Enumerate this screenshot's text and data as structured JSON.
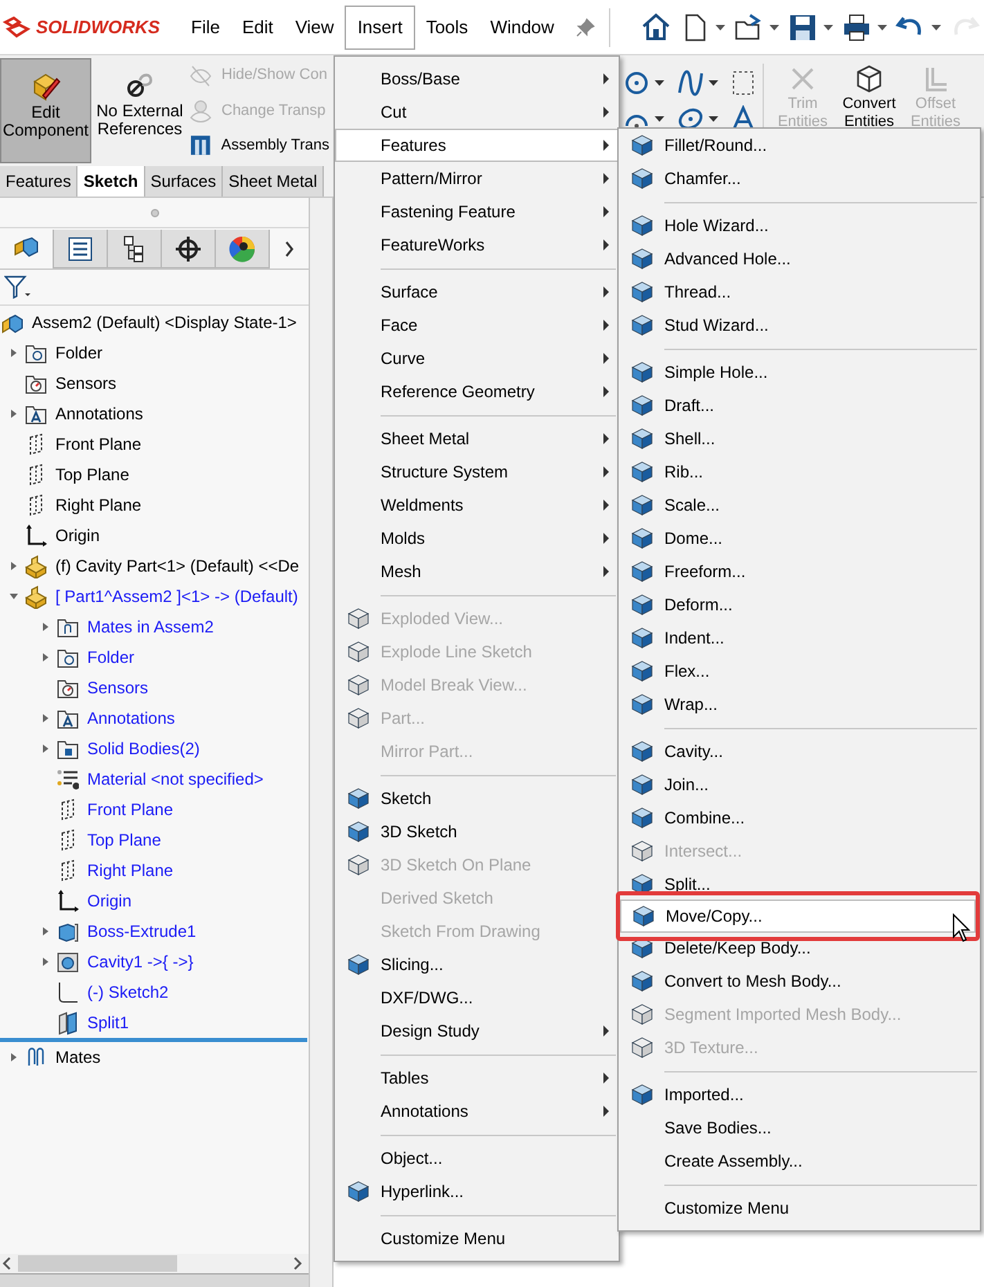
{
  "app": {
    "logo": "SOLIDWORKS"
  },
  "menu_bar": [
    {
      "label": "File",
      "selected": false
    },
    {
      "label": "Edit",
      "selected": false
    },
    {
      "label": "View",
      "selected": false
    },
    {
      "label": "Insert",
      "selected": true
    },
    {
      "label": "Tools",
      "selected": false
    },
    {
      "label": "Window",
      "selected": false
    }
  ],
  "quick_access": [
    {
      "kind": "home",
      "dropdown": false,
      "disabled": false
    },
    {
      "kind": "new",
      "dropdown": true,
      "disabled": false
    },
    {
      "kind": "open",
      "dropdown": true,
      "disabled": false
    },
    {
      "kind": "save",
      "dropdown": true,
      "disabled": false
    },
    {
      "kind": "print",
      "dropdown": true,
      "disabled": false
    },
    {
      "kind": "undo",
      "dropdown": true,
      "disabled": false
    },
    {
      "kind": "redo",
      "dropdown": false,
      "disabled": true
    }
  ],
  "command_manager": {
    "large_buttons": [
      {
        "label": "Edit Component",
        "kind": "edit-component",
        "selected": true
      },
      {
        "label": "No External References",
        "kind": "no-references",
        "selected": false
      }
    ],
    "small_buttons": [
      {
        "label": "Hide/Show Con",
        "kind": "hide-show",
        "disabled": true
      },
      {
        "label": "Change Transp",
        "kind": "transparency",
        "disabled": true
      },
      {
        "label": "Assembly Trans",
        "kind": "assembly-transparency",
        "disabled": false
      }
    ],
    "entity_buttons": [
      {
        "label": "Trim Entities",
        "kind": "trim",
        "disabled": true
      },
      {
        "label": "Convert Entities",
        "kind": "convert",
        "disabled": false
      },
      {
        "label": "Offset Entities",
        "kind": "offset",
        "disabled": true
      }
    ]
  },
  "command_tabs": [
    {
      "label": "Features",
      "selected": false
    },
    {
      "label": "Sketch",
      "selected": true
    },
    {
      "label": "Surfaces",
      "selected": false
    },
    {
      "label": "Sheet Metal",
      "selected": false
    }
  ],
  "panel_tabs": [
    {
      "kind": "feature-manager",
      "selected": true
    },
    {
      "kind": "property-manager",
      "selected": false
    },
    {
      "kind": "configuration-manager",
      "selected": false
    },
    {
      "kind": "dimxpert",
      "selected": false
    },
    {
      "kind": "display-manager",
      "selected": false
    }
  ],
  "tree": {
    "label": "Assem2 (Default) <Display State-1>",
    "kind": "assembly",
    "children": [
      {
        "label": "Folder",
        "kind": "folder",
        "editing": false,
        "expanded": false
      },
      {
        "label": "Sensors",
        "kind": "sensors",
        "editing": false
      },
      {
        "label": "Annotations",
        "kind": "annotations",
        "editing": false,
        "expanded": false
      },
      {
        "label": "Front Plane",
        "kind": "plane",
        "editing": false
      },
      {
        "label": "Top Plane",
        "kind": "plane",
        "editing": false
      },
      {
        "label": "Right Plane",
        "kind": "plane",
        "editing": false
      },
      {
        "label": "Origin",
        "kind": "origin",
        "editing": false
      },
      {
        "label": "(f) Cavity Part<1> (Default) <<De",
        "kind": "part",
        "editing": false,
        "expanded": false
      },
      {
        "label": "[ Part1^Assem2 ]<1> -> (Default)",
        "kind": "part",
        "editing": true,
        "expanded": true,
        "children": [
          {
            "label": "Mates in Assem2",
            "kind": "mates-folder",
            "expanded": false
          },
          {
            "label": "Folder",
            "kind": "folder",
            "expanded": false
          },
          {
            "label": "Sensors",
            "kind": "sensors"
          },
          {
            "label": "Annotations",
            "kind": "annotations",
            "expanded": false
          },
          {
            "label": "Solid Bodies(2)",
            "kind": "bodies",
            "expanded": false
          },
          {
            "label": "Material <not specified>",
            "kind": "material"
          },
          {
            "label": "Front Plane",
            "kind": "plane"
          },
          {
            "label": "Top Plane",
            "kind": "plane"
          },
          {
            "label": "Right Plane",
            "kind": "plane"
          },
          {
            "label": "Origin",
            "kind": "origin"
          },
          {
            "label": "Boss-Extrude1",
            "kind": "extrude",
            "expanded": false
          },
          {
            "label": "Cavity1 ->{ ->}",
            "kind": "cavity",
            "expanded": false
          },
          {
            "label": "(-) Sketch2",
            "kind": "sketch"
          },
          {
            "label": "Split1",
            "kind": "split"
          }
        ]
      },
      {
        "label": "Mates",
        "kind": "mates",
        "editing": false,
        "expanded": false
      }
    ]
  },
  "insert_menu": {
    "sections": [
      [
        {
          "label": "Boss/Base",
          "submenu": true,
          "icon": false,
          "disabled": false,
          "selected": false
        },
        {
          "label": "Cut",
          "submenu": true,
          "icon": false,
          "disabled": false,
          "selected": false
        },
        {
          "label": "Features",
          "submenu": true,
          "icon": false,
          "disabled": false,
          "selected": true
        },
        {
          "label": "Pattern/Mirror",
          "submenu": true,
          "icon": false,
          "disabled": false,
          "selected": false
        },
        {
          "label": "Fastening Feature",
          "submenu": true,
          "icon": false,
          "disabled": false,
          "selected": false
        },
        {
          "label": "FeatureWorks",
          "submenu": true,
          "icon": false,
          "disabled": false,
          "selected": false
        }
      ],
      [
        {
          "label": "Surface",
          "submenu": true,
          "icon": false,
          "disabled": false,
          "selected": false
        },
        {
          "label": "Face",
          "submenu": true,
          "icon": false,
          "disabled": false,
          "selected": false
        },
        {
          "label": "Curve",
          "submenu": true,
          "icon": false,
          "disabled": false,
          "selected": false
        },
        {
          "label": "Reference Geometry",
          "submenu": true,
          "icon": false,
          "disabled": false,
          "selected": false
        }
      ],
      [
        {
          "label": "Sheet Metal",
          "submenu": true,
          "icon": false,
          "disabled": false,
          "selected": false
        },
        {
          "label": "Structure System",
          "submenu": true,
          "icon": false,
          "disabled": false,
          "selected": false
        },
        {
          "label": "Weldments",
          "submenu": true,
          "icon": false,
          "disabled": false,
          "selected": false
        },
        {
          "label": "Molds",
          "submenu": true,
          "icon": false,
          "disabled": false,
          "selected": false
        },
        {
          "label": "Mesh",
          "submenu": true,
          "icon": false,
          "disabled": false,
          "selected": false
        }
      ],
      [
        {
          "label": "Exploded View...",
          "submenu": false,
          "icon": true,
          "disabled": true,
          "selected": false
        },
        {
          "label": "Explode Line Sketch",
          "submenu": false,
          "icon": true,
          "disabled": true,
          "selected": false
        },
        {
          "label": "Model Break View...",
          "submenu": false,
          "icon": true,
          "disabled": true,
          "selected": false
        },
        {
          "label": "Part...",
          "submenu": false,
          "icon": true,
          "disabled": true,
          "selected": false
        },
        {
          "label": "Mirror Part...",
          "submenu": false,
          "icon": false,
          "disabled": true,
          "selected": false
        }
      ],
      [
        {
          "label": "Sketch",
          "submenu": false,
          "icon": true,
          "disabled": false,
          "selected": false
        },
        {
          "label": "3D Sketch",
          "submenu": false,
          "icon": true,
          "disabled": false,
          "selected": false
        },
        {
          "label": "3D Sketch On Plane",
          "submenu": false,
          "icon": true,
          "disabled": true,
          "selected": false
        },
        {
          "label": "Derived Sketch",
          "submenu": false,
          "icon": false,
          "disabled": true,
          "selected": false
        },
        {
          "label": "Sketch From Drawing",
          "submenu": false,
          "icon": false,
          "disabled": true,
          "selected": false
        },
        {
          "label": "Slicing...",
          "submenu": false,
          "icon": true,
          "disabled": false,
          "selected": false
        },
        {
          "label": "DXF/DWG...",
          "submenu": false,
          "icon": false,
          "disabled": false,
          "selected": false
        },
        {
          "label": "Design Study",
          "submenu": true,
          "icon": false,
          "disabled": false,
          "selected": false
        }
      ],
      [
        {
          "label": "Tables",
          "submenu": true,
          "icon": false,
          "disabled": false,
          "selected": false
        },
        {
          "label": "Annotations",
          "submenu": true,
          "icon": false,
          "disabled": false,
          "selected": false
        }
      ],
      [
        {
          "label": "Object...",
          "submenu": false,
          "icon": false,
          "disabled": false,
          "selected": false
        },
        {
          "label": "Hyperlink...",
          "submenu": false,
          "icon": true,
          "disabled": false,
          "selected": false
        }
      ],
      [
        {
          "label": "Customize Menu",
          "submenu": false,
          "icon": false,
          "disabled": false,
          "selected": false
        }
      ]
    ]
  },
  "features_submenu": {
    "sections": [
      [
        {
          "label": "Fillet/Round...",
          "icon": true,
          "disabled": false,
          "selected": false,
          "annotated": false
        },
        {
          "label": "Chamfer...",
          "icon": true,
          "disabled": false,
          "selected": false,
          "annotated": false
        }
      ],
      [
        {
          "label": "Hole Wizard...",
          "icon": true,
          "disabled": false,
          "selected": false,
          "annotated": false
        },
        {
          "label": "Advanced Hole...",
          "icon": true,
          "disabled": false,
          "selected": false,
          "annotated": false
        },
        {
          "label": "Thread...",
          "icon": true,
          "disabled": false,
          "selected": false,
          "annotated": false
        },
        {
          "label": "Stud Wizard...",
          "icon": true,
          "disabled": false,
          "selected": false,
          "annotated": false
        }
      ],
      [
        {
          "label": "Simple Hole...",
          "icon": true,
          "disabled": false,
          "selected": false,
          "annotated": false
        },
        {
          "label": "Draft...",
          "icon": true,
          "disabled": false,
          "selected": false,
          "annotated": false
        },
        {
          "label": "Shell...",
          "icon": true,
          "disabled": false,
          "selected": false,
          "annotated": false
        },
        {
          "label": "Rib...",
          "icon": true,
          "disabled": false,
          "selected": false,
          "annotated": false
        },
        {
          "label": "Scale...",
          "icon": true,
          "disabled": false,
          "selected": false,
          "annotated": false
        },
        {
          "label": "Dome...",
          "icon": true,
          "disabled": false,
          "selected": false,
          "annotated": false
        },
        {
          "label": "Freeform...",
          "icon": true,
          "disabled": false,
          "selected": false,
          "annotated": false
        },
        {
          "label": "Deform...",
          "icon": true,
          "disabled": false,
          "selected": false,
          "annotated": false
        },
        {
          "label": "Indent...",
          "icon": true,
          "disabled": false,
          "selected": false,
          "annotated": false
        },
        {
          "label": "Flex...",
          "icon": true,
          "disabled": false,
          "selected": false,
          "annotated": false
        },
        {
          "label": "Wrap...",
          "icon": true,
          "disabled": false,
          "selected": false,
          "annotated": false
        }
      ],
      [
        {
          "label": "Cavity...",
          "icon": true,
          "disabled": false,
          "selected": false,
          "annotated": false
        },
        {
          "label": "Join...",
          "icon": true,
          "disabled": false,
          "selected": false,
          "annotated": false
        },
        {
          "label": "Combine...",
          "icon": true,
          "disabled": false,
          "selected": false,
          "annotated": false
        },
        {
          "label": "Intersect...",
          "icon": true,
          "disabled": true,
          "selected": false,
          "annotated": false
        },
        {
          "label": "Split...",
          "icon": true,
          "disabled": false,
          "selected": false,
          "annotated": false
        },
        {
          "label": "Move/Copy...",
          "icon": true,
          "disabled": false,
          "selected": true,
          "annotated": true
        },
        {
          "label": "Delete/Keep Body...",
          "icon": true,
          "disabled": false,
          "selected": false,
          "annotated": false
        },
        {
          "label": "Convert to Mesh Body...",
          "icon": true,
          "disabled": false,
          "selected": false,
          "annotated": false
        },
        {
          "label": "Segment Imported Mesh Body...",
          "icon": true,
          "disabled": true,
          "selected": false,
          "annotated": false
        },
        {
          "label": "3D Texture...",
          "icon": true,
          "disabled": true,
          "selected": false,
          "annotated": false
        }
      ],
      [
        {
          "label": "Imported...",
          "icon": true,
          "disabled": false,
          "selected": false,
          "annotated": false
        },
        {
          "label": "Save Bodies...",
          "icon": false,
          "disabled": false,
          "selected": false,
          "annotated": false
        },
        {
          "label": "Create Assembly...",
          "icon": false,
          "disabled": false,
          "selected": false,
          "annotated": false
        }
      ],
      [
        {
          "label": "Customize Menu",
          "icon": false,
          "disabled": false,
          "selected": false,
          "annotated": false
        }
      ]
    ]
  }
}
